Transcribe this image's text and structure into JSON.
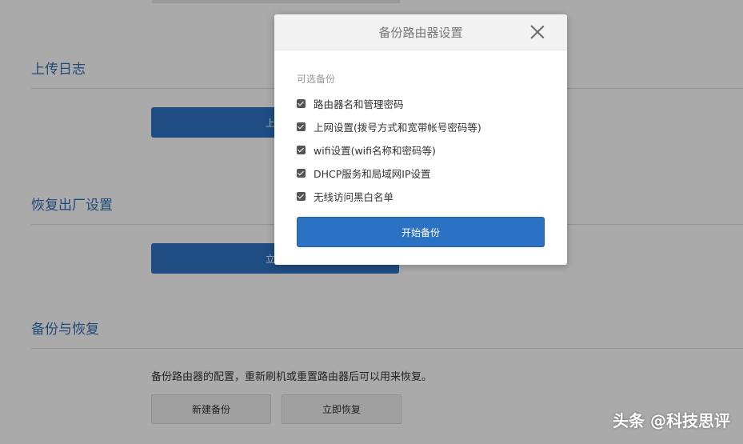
{
  "sections": {
    "upload_log": {
      "title": "上传日志",
      "button": "上传"
    },
    "factory_reset": {
      "title": "恢复出厂设置",
      "button": "立即"
    },
    "backup_restore": {
      "title": "备份与恢复",
      "description": "备份路由器的配置，重新刷机或重置路由器后可以用来恢复。",
      "new_backup": "新建备份",
      "restore_now": "立即恢复"
    }
  },
  "modal": {
    "title": "备份路由器设置",
    "options_label": "可选备份",
    "options": [
      {
        "label": "路由器名和管理密码",
        "checked": true
      },
      {
        "label": "上网设置(拨号方式和宽带帐号密码等)",
        "checked": true
      },
      {
        "label": "wifi设置(wifi名称和密码等)",
        "checked": true
      },
      {
        "label": "DHCP服务和局域网IP设置",
        "checked": true
      },
      {
        "label": "无线访问黑白名单",
        "checked": true
      }
    ],
    "start_button": "开始备份"
  },
  "watermark": "头条 @科技思评",
  "colors": {
    "accent": "#2b72c2",
    "overlay": "rgba(0,0,0,0.32)"
  }
}
